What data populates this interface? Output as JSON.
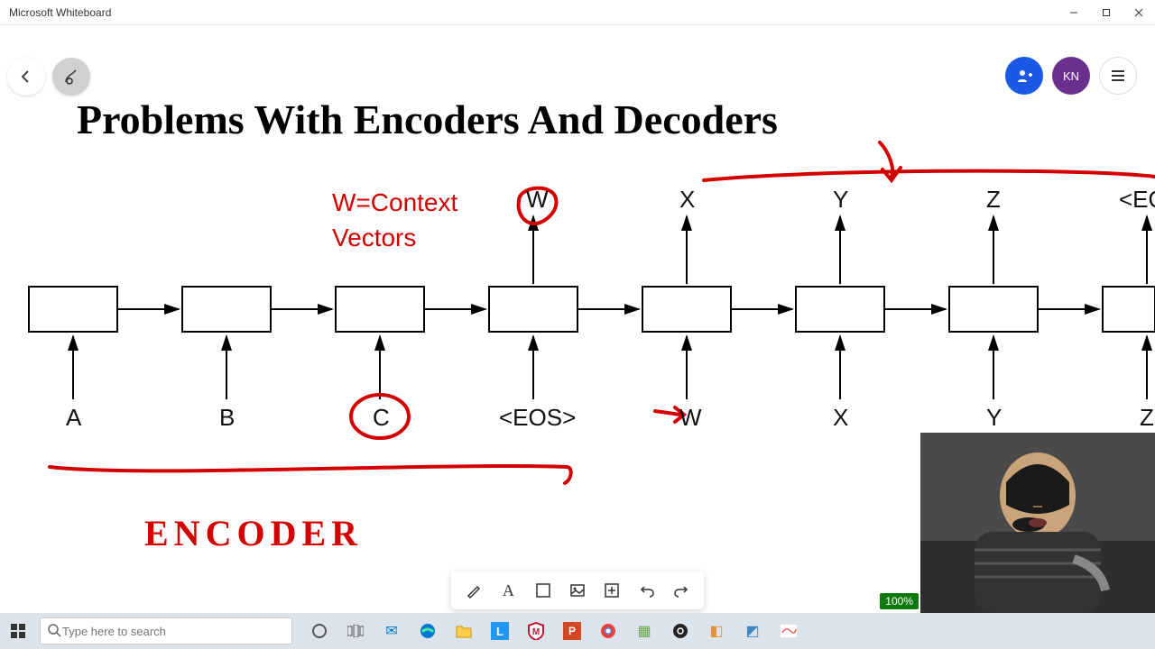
{
  "window": {
    "title": "Microsoft Whiteboard"
  },
  "heading": "Problems With Encoders And Decoders",
  "annotations": {
    "context_line1": "W=Context",
    "context_line2": "Vectors",
    "encoder": "ENCODER"
  },
  "outputs": {
    "w": "W",
    "x": "X",
    "y": "Y",
    "z": "Z",
    "eos": "<EO"
  },
  "inputs": {
    "a": "A",
    "b": "B",
    "c": "C",
    "eos": "<EOS>",
    "w": "W",
    "x": "X",
    "y": "Y",
    "z": "Z"
  },
  "avatar": {
    "initials": "KN"
  },
  "search": {
    "placeholder": "Type here to search"
  },
  "zoom": "100%"
}
